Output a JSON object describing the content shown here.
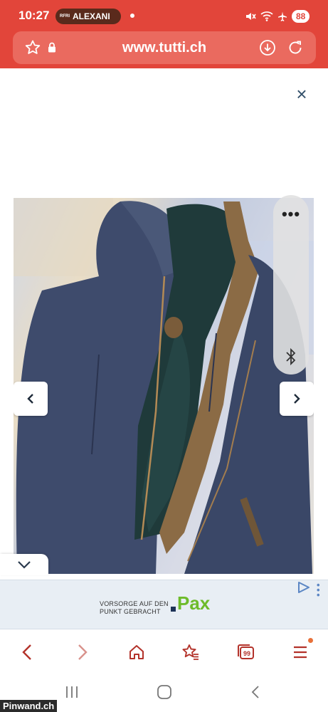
{
  "status": {
    "time": "10:27",
    "pill_mini": "RFRI",
    "pill_text": "ALEXANI",
    "battery": "88"
  },
  "browser": {
    "url": "www.tutti.ch"
  },
  "gallery": {
    "close_label": "×"
  },
  "ad": {
    "line1": "VORSORGE AUF DEN",
    "line2": "PUNKT GEBRACHT",
    "brand": "Pax"
  },
  "watermark": "Pinwand.ch",
  "colors": {
    "header": "#e2453a",
    "url_field": "#ea6a5f",
    "toolbar_icons": "#b3322a",
    "ad_brand": "#6dbb2a"
  }
}
